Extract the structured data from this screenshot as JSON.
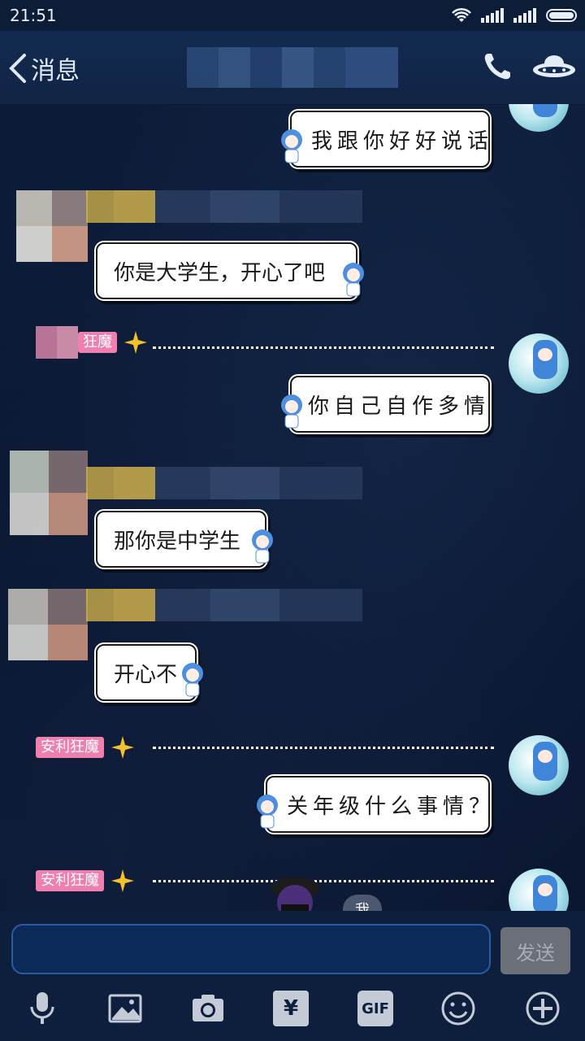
{
  "status_bar": {
    "time": "21:51"
  },
  "header": {
    "back_label": "消息"
  },
  "messages": [
    {
      "side": "right",
      "text": "我跟你好好说话",
      "style": "handwriting"
    },
    {
      "side": "left",
      "text": "你是大学生，开心了吧",
      "style": "normal"
    },
    {
      "side": "right",
      "text": "你自己自作多情",
      "style": "handwriting"
    },
    {
      "side": "left",
      "text": "那你是中学生",
      "style": "normal"
    },
    {
      "side": "left",
      "text": "开心不",
      "style": "normal"
    },
    {
      "side": "right",
      "text": "关年级什么事情？",
      "style": "handwriting"
    }
  ],
  "nick_tags": [
    "狂魔",
    "安利狂魔",
    "安利狂魔"
  ],
  "mention_label": "我",
  "input": {
    "placeholder": "",
    "send_label": "发送"
  },
  "toolbar": {
    "items": [
      "mic-icon",
      "image-icon",
      "camera-icon",
      "red-packet-icon",
      "gif-icon",
      "emoji-icon",
      "plus-icon"
    ],
    "gif_label": "GIF",
    "red_packet_symbol": "¥"
  },
  "colors": {
    "background": "#0c1a33",
    "nick_tag": "#ee7fae",
    "send_disabled": "#6b6f78"
  }
}
